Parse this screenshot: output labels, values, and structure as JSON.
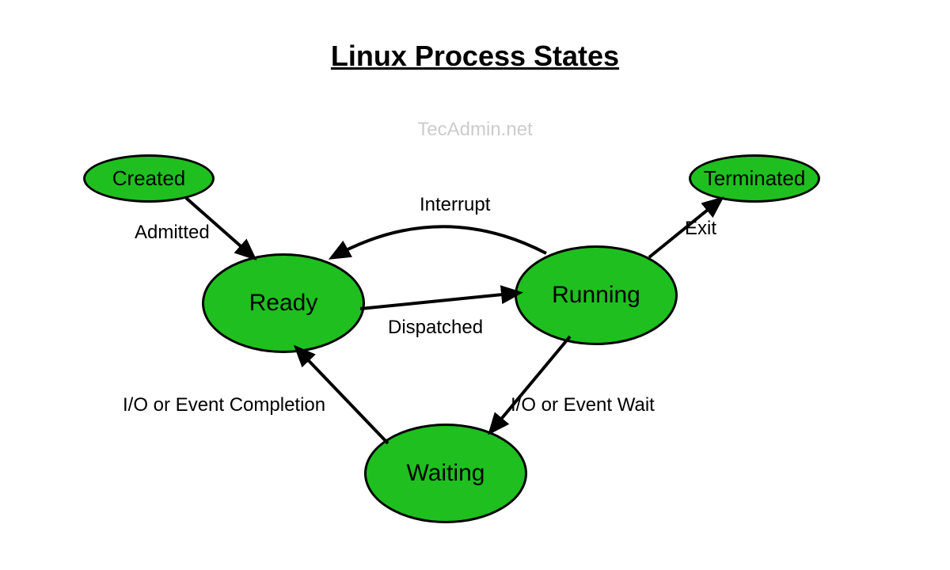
{
  "title": "Linux Process States",
  "watermark": "TecAdmin.net",
  "states": {
    "created": "Created",
    "terminated": "Terminated",
    "ready": "Ready",
    "running": "Running",
    "waiting": "Waiting"
  },
  "transitions": {
    "admitted": "Admitted",
    "interrupt": "Interrupt",
    "exit": "Exit",
    "dispatched": "Dispatched",
    "io_completion": "I/O or Event Completion",
    "io_wait": "I/O or Event Wait"
  },
  "colors": {
    "node_fill": "#1fbf1f",
    "node_stroke": "#000000",
    "edge_stroke": "#000000"
  }
}
